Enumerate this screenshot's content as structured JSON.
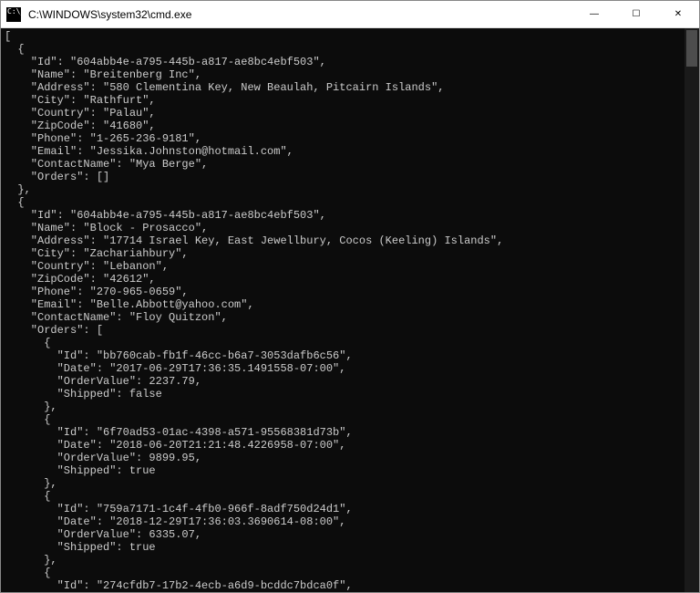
{
  "window": {
    "title": "C:\\WINDOWS\\system32\\cmd.exe"
  },
  "controls": {
    "minimize": "—",
    "maximize": "☐",
    "close": "✕"
  },
  "terminal_output": "[\n  {\n    \"Id\": \"604abb4e-a795-445b-a817-ae8bc4ebf503\",\n    \"Name\": \"Breitenberg Inc\",\n    \"Address\": \"580 Clementina Key, New Beaulah, Pitcairn Islands\",\n    \"City\": \"Rathfurt\",\n    \"Country\": \"Palau\",\n    \"ZipCode\": \"41680\",\n    \"Phone\": \"1-265-236-9181\",\n    \"Email\": \"Jessika.Johnston@hotmail.com\",\n    \"ContactName\": \"Mya Berge\",\n    \"Orders\": []\n  },\n  {\n    \"Id\": \"604abb4e-a795-445b-a817-ae8bc4ebf503\",\n    \"Name\": \"Block - Prosacco\",\n    \"Address\": \"17714 Israel Key, East Jewellbury, Cocos (Keeling) Islands\",\n    \"City\": \"Zachariahbury\",\n    \"Country\": \"Lebanon\",\n    \"ZipCode\": \"42612\",\n    \"Phone\": \"270-965-0659\",\n    \"Email\": \"Belle.Abbott@yahoo.com\",\n    \"ContactName\": \"Floy Quitzon\",\n    \"Orders\": [\n      {\n        \"Id\": \"bb760cab-fb1f-46cc-b6a7-3053dafb6c56\",\n        \"Date\": \"2017-06-29T17:36:35.1491558-07:00\",\n        \"OrderValue\": 2237.79,\n        \"Shipped\": false\n      },\n      {\n        \"Id\": \"6f70ad53-01ac-4398-a571-95568381d73b\",\n        \"Date\": \"2018-06-20T21:21:48.4226958-07:00\",\n        \"OrderValue\": 9899.95,\n        \"Shipped\": true\n      },\n      {\n        \"Id\": \"759a7171-1c4f-4fb0-966f-8adf750d24d1\",\n        \"Date\": \"2018-12-29T17:36:03.3690614-08:00\",\n        \"OrderValue\": 6335.07,\n        \"Shipped\": true\n      },\n      {\n        \"Id\": \"274cfdb7-17b2-4ecb-a6d9-bcddc7bdca0f\","
}
